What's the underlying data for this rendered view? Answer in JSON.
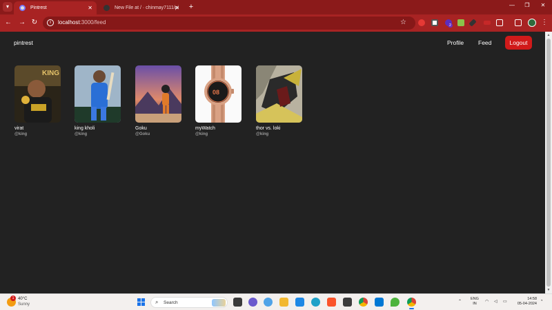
{
  "browser": {
    "tabs": [
      {
        "title": "Pintrest",
        "close": "✕"
      },
      {
        "title": "New File at / · chinmay7111/pi",
        "close": "✕"
      }
    ],
    "newtab": "+",
    "window_controls": {
      "minimize": "—",
      "restore": "❐",
      "close": "✕"
    },
    "url_host": "localhost",
    "url_path": ":3000/feed",
    "ext_badge": "2"
  },
  "app": {
    "brand": "pintrest",
    "nav": {
      "profile": "Profile",
      "feed": "Feed",
      "logout": "Logout"
    },
    "posts": [
      {
        "title": "virat",
        "handle": "@king"
      },
      {
        "title": "king kholi",
        "handle": "@king"
      },
      {
        "title": "Goku",
        "handle": "@Goku"
      },
      {
        "title": "myWatch",
        "handle": "@king"
      },
      {
        "title": "thor vs. loki",
        "handle": "@king"
      }
    ]
  },
  "taskbar": {
    "weather_temp": "40°C",
    "weather_cond": "Sunny",
    "weather_badge": "1",
    "search_placeholder": "Search",
    "lang_line1": "ENG",
    "lang_line2": "IN",
    "time": "14:58",
    "date": "05-04-2024"
  }
}
